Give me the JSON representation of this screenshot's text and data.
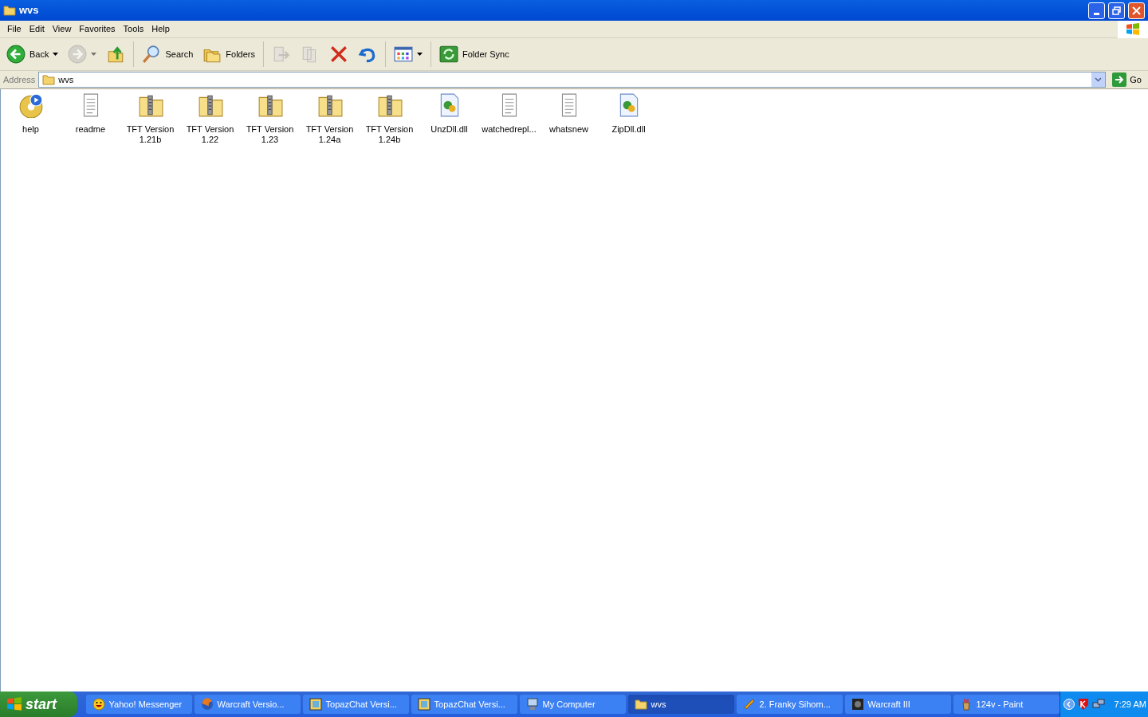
{
  "window": {
    "title": "wvs"
  },
  "menu": [
    "File",
    "Edit",
    "View",
    "Favorites",
    "Tools",
    "Help"
  ],
  "toolbar": [
    {
      "kind": "back",
      "label": "Back",
      "dropdown": true,
      "disabled": false
    },
    {
      "kind": "forward",
      "dropdown": true,
      "disabled": true
    },
    {
      "kind": "up",
      "disabled": false
    },
    {
      "kind": "separator"
    },
    {
      "kind": "search",
      "label": "Search",
      "disabled": false
    },
    {
      "kind": "folders",
      "label": "Folders",
      "disabled": false
    },
    {
      "kind": "separator"
    },
    {
      "kind": "move",
      "disabled": true
    },
    {
      "kind": "copy",
      "disabled": true
    },
    {
      "kind": "delete",
      "disabled": false
    },
    {
      "kind": "undo",
      "disabled": false
    },
    {
      "kind": "separator"
    },
    {
      "kind": "views",
      "dropdown": true,
      "disabled": false
    },
    {
      "kind": "separator"
    },
    {
      "kind": "sync",
      "label": "Folder Sync",
      "disabled": false
    }
  ],
  "address": {
    "label": "Address",
    "value": "wvs",
    "go": "Go"
  },
  "files": [
    {
      "kind": "help",
      "name": "help"
    },
    {
      "kind": "text",
      "name": "readme"
    },
    {
      "kind": "zip",
      "name": "TFT Version 1.21b"
    },
    {
      "kind": "zip",
      "name": "TFT Version 1.22"
    },
    {
      "kind": "zip",
      "name": "TFT Version 1.23"
    },
    {
      "kind": "zip",
      "name": "TFT Version 1.24a"
    },
    {
      "kind": "zip",
      "name": "TFT Version 1.24b"
    },
    {
      "kind": "dll",
      "name": "UnzDll.dll"
    },
    {
      "kind": "text",
      "name": "watchedrepl..."
    },
    {
      "kind": "text",
      "name": "whatsnew"
    },
    {
      "kind": "dll",
      "name": "ZipDll.dll"
    }
  ],
  "taskbar": {
    "start": "start",
    "items": [
      {
        "kind": "smiley",
        "label": "Yahoo! Messenger",
        "selected": false
      },
      {
        "kind": "browser",
        "label": "Warcraft Versio...",
        "selected": false
      },
      {
        "kind": "chat",
        "label": "TopazChat Versi...",
        "selected": false
      },
      {
        "kind": "chat",
        "label": "TopazChat Versi...",
        "selected": false
      },
      {
        "kind": "computer",
        "label": "My Computer",
        "selected": false
      },
      {
        "kind": "folder",
        "label": "wvs",
        "selected": true
      },
      {
        "kind": "media",
        "label": "2. Franky Sihom...",
        "selected": false
      },
      {
        "kind": "game",
        "label": "Warcraft III",
        "selected": false
      },
      {
        "kind": "paint",
        "label": "124v - Paint",
        "selected": false
      }
    ],
    "clock": "7:29 AM"
  }
}
